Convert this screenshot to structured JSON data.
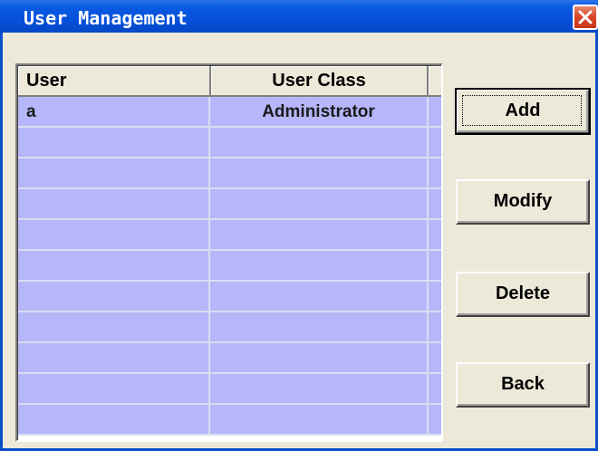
{
  "window": {
    "title": "User Management",
    "close_icon": "close-icon"
  },
  "table": {
    "columns": [
      "User",
      "User Class"
    ],
    "rows": [
      {
        "user": "a",
        "user_class": "Administrator"
      },
      {
        "user": "",
        "user_class": ""
      },
      {
        "user": "",
        "user_class": ""
      },
      {
        "user": "",
        "user_class": ""
      },
      {
        "user": "",
        "user_class": ""
      },
      {
        "user": "",
        "user_class": ""
      },
      {
        "user": "",
        "user_class": ""
      },
      {
        "user": "",
        "user_class": ""
      },
      {
        "user": "",
        "user_class": ""
      },
      {
        "user": "",
        "user_class": ""
      },
      {
        "user": "",
        "user_class": ""
      }
    ]
  },
  "buttons": {
    "add": "Add",
    "modify": "Modify",
    "delete": "Delete",
    "back": "Back"
  },
  "colors": {
    "titlebar": "#0550dc",
    "row_background": "#b6b6fa",
    "dialog_background": "#ece9d8",
    "close_button": "#d9482b"
  }
}
